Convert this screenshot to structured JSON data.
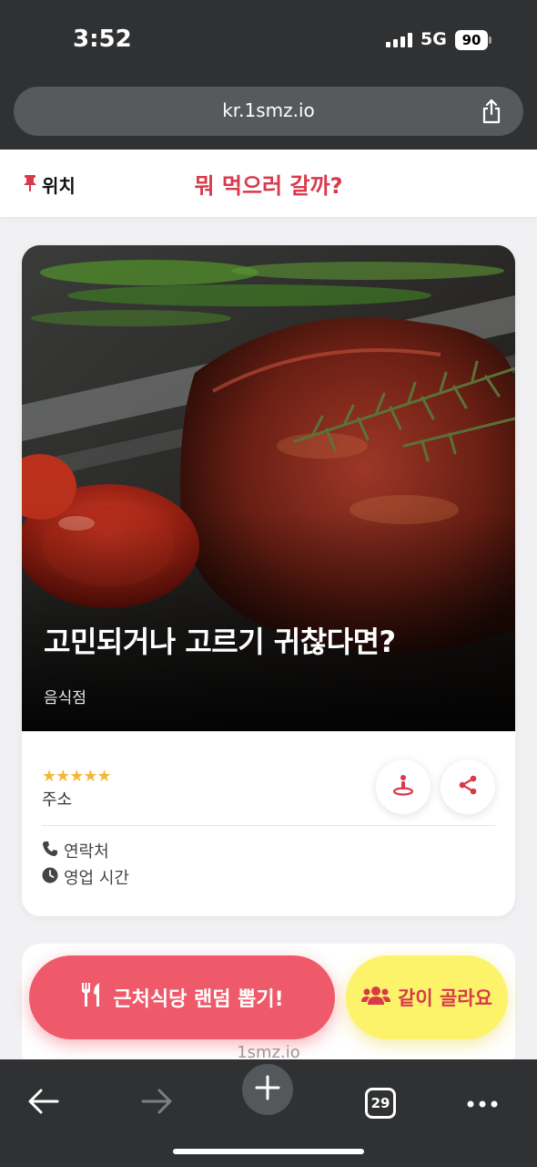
{
  "status_bar": {
    "time": "3:52",
    "network": "5G",
    "battery": "90"
  },
  "browser": {
    "url": "kr.1smz.io",
    "tab_count": "29"
  },
  "header": {
    "location_label": "위치",
    "title": "뭐 먹으러 갈까?"
  },
  "card": {
    "title": "고민되거나 고르기 귀찮다면?",
    "category": "음식점",
    "rating": 5,
    "rating_stars": "★★★★★",
    "address_label": "주소",
    "phone_label": "연락처",
    "hours_label": "영업 시간"
  },
  "fabs": {
    "random_label": "근처식당 랜덤 뽑기!",
    "together_label": "같이 골라요"
  },
  "footer_text": "1smz.io",
  "colors": {
    "accent": "#d8394b",
    "fab_red": "#ee5a6a",
    "fab_yellow": "#fdf36a",
    "star": "#f4b73a",
    "chrome": "#2f3133"
  }
}
